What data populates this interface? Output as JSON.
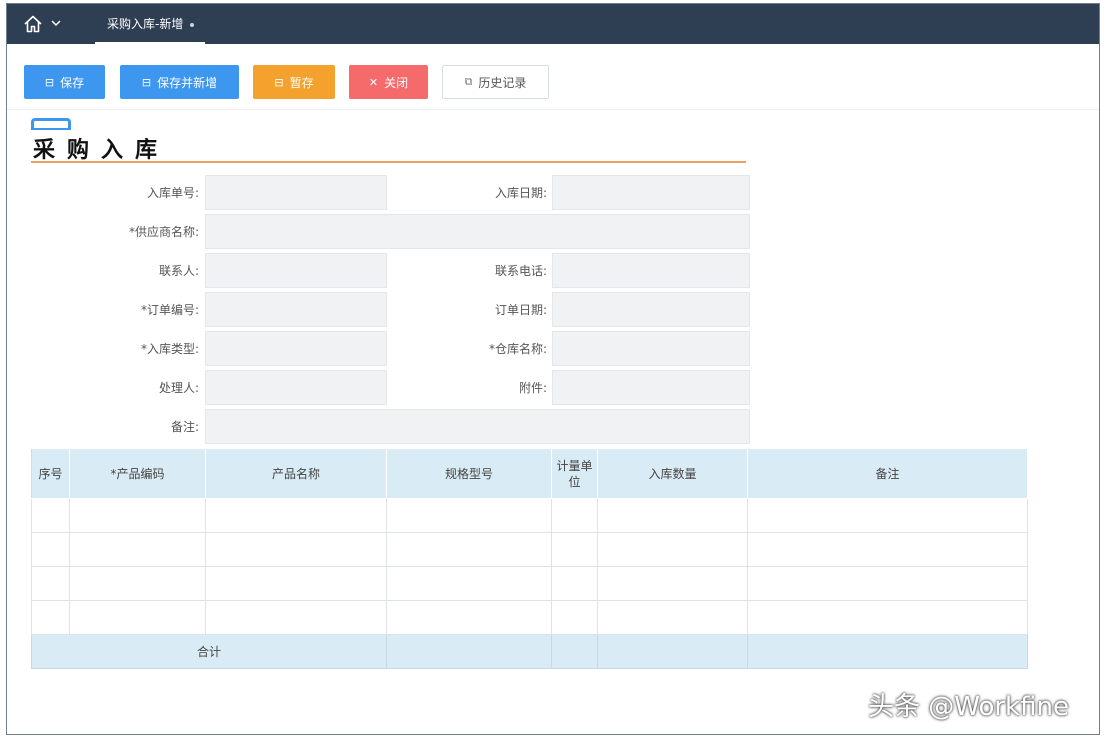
{
  "tab": {
    "label": "采购入库-新增"
  },
  "toolbar": {
    "save": "保存",
    "save_new": "保存并新增",
    "draft": "暂存",
    "close": "关闭",
    "history": "历史记录"
  },
  "form": {
    "title": "采购入库",
    "fields": {
      "entry_no": "入库单号:",
      "entry_date": "入库日期:",
      "supplier": "*供应商名称:",
      "contact": "联系人:",
      "phone": "联系电话:",
      "order_no": "*订单编号:",
      "order_date": "订单日期:",
      "entry_type": "*入库类型:",
      "warehouse": "*仓库名称:",
      "handler": "处理人:",
      "attachment": "附件:",
      "remark": "备注:"
    }
  },
  "table": {
    "headers": [
      "序号",
      "*产品编码",
      "产品名称",
      "规格型号",
      "计量单位",
      "入库数量",
      "备注"
    ],
    "total_label": "合计"
  },
  "watermark": "头条 @Workfine",
  "colors": {
    "primary": "#3d97ef",
    "warning": "#f4a12e",
    "danger": "#f56a6a",
    "topbar": "#2e3e53",
    "table_header": "#d9ebf5"
  }
}
